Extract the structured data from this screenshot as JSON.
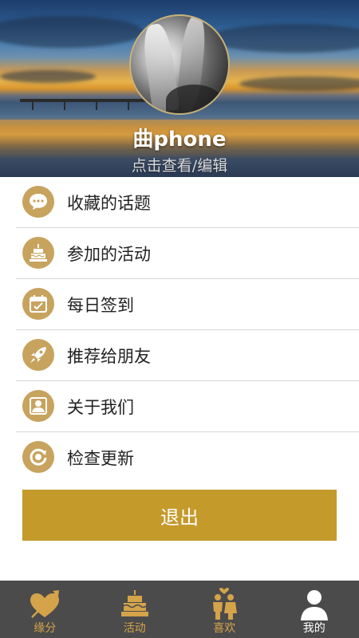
{
  "profile": {
    "username": "曲phone",
    "subtitle": "点击查看/编辑"
  },
  "menu": {
    "items": [
      {
        "label": "收藏的话题",
        "icon": "chat-bubble-icon"
      },
      {
        "label": "参加的活动",
        "icon": "cake-icon"
      },
      {
        "label": "每日签到",
        "icon": "calendar-icon"
      },
      {
        "label": "推荐给朋友",
        "icon": "rocket-icon"
      },
      {
        "label": "关于我们",
        "icon": "user-icon"
      },
      {
        "label": "检查更新",
        "icon": "refresh-icon"
      }
    ]
  },
  "logout": {
    "label": "退出"
  },
  "tabbar": {
    "tabs": [
      {
        "label": "缘分",
        "icon": "heart-arrow-icon",
        "active": false
      },
      {
        "label": "活动",
        "icon": "cake-icon",
        "active": false
      },
      {
        "label": "喜欢",
        "icon": "couple-icon",
        "active": false
      },
      {
        "label": "我的",
        "icon": "person-icon",
        "active": true
      }
    ]
  },
  "colors": {
    "accent": "#c49a2b",
    "icon_bg": "#c7a35e",
    "tabbar_bg": "#4b4b4b",
    "tab_inactive": "#d4a34a",
    "tab_active": "#ffffff"
  }
}
